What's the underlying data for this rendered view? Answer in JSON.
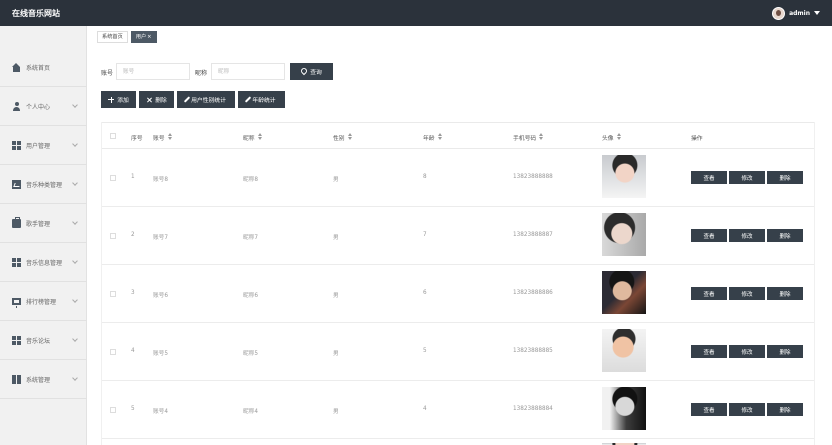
{
  "topbar": {
    "site_title": "在线音乐网站",
    "username": "admin"
  },
  "sidebar": {
    "items": [
      {
        "label": "系统首页",
        "icon": "home-icon"
      },
      {
        "label": "个人中心",
        "icon": "user-icon"
      },
      {
        "label": "用户管理",
        "icon": "grid-icon"
      },
      {
        "label": "音乐种类管理",
        "icon": "chart-icon"
      },
      {
        "label": "歌手管理",
        "icon": "case-icon"
      },
      {
        "label": "音乐信息管理",
        "icon": "grid-icon"
      },
      {
        "label": "排行榜管理",
        "icon": "monitor-icon"
      },
      {
        "label": "音乐论坛",
        "icon": "grid-icon"
      },
      {
        "label": "系统管理",
        "icon": "book-icon"
      }
    ]
  },
  "tabs": {
    "home": "系统首页",
    "user": "用户",
    "close": "×"
  },
  "search": {
    "account_label": "账号",
    "account_placeholder": "账号",
    "nickname_label": "昵称",
    "nickname_placeholder": "昵称",
    "query_button": "查询"
  },
  "toolbar": {
    "add": "添加",
    "delete": "删除",
    "gender_stats": "用户性别统计",
    "age_stats": "年龄统计"
  },
  "table": {
    "headers": {
      "index": "序号",
      "account": "账号",
      "nickname": "昵称",
      "gender": "性别",
      "age": "年龄",
      "phone": "手机号码",
      "avatar": "头像",
      "actions": "操作"
    },
    "rows": [
      {
        "index": "1",
        "account": "账号8",
        "nickname": "昵称8",
        "gender": "男",
        "age": "8",
        "phone": "13823888888"
      },
      {
        "index": "2",
        "account": "账号7",
        "nickname": "昵称7",
        "gender": "男",
        "age": "7",
        "phone": "13823888887"
      },
      {
        "index": "3",
        "account": "账号6",
        "nickname": "昵称6",
        "gender": "男",
        "age": "6",
        "phone": "13823888886"
      },
      {
        "index": "4",
        "account": "账号5",
        "nickname": "昵称5",
        "gender": "男",
        "age": "5",
        "phone": "13823888885"
      },
      {
        "index": "5",
        "account": "账号4",
        "nickname": "昵称4",
        "gender": "男",
        "age": "4",
        "phone": "13823888884"
      }
    ],
    "row_actions": {
      "view": "查看",
      "edit": "修改",
      "delete": "删除"
    }
  }
}
